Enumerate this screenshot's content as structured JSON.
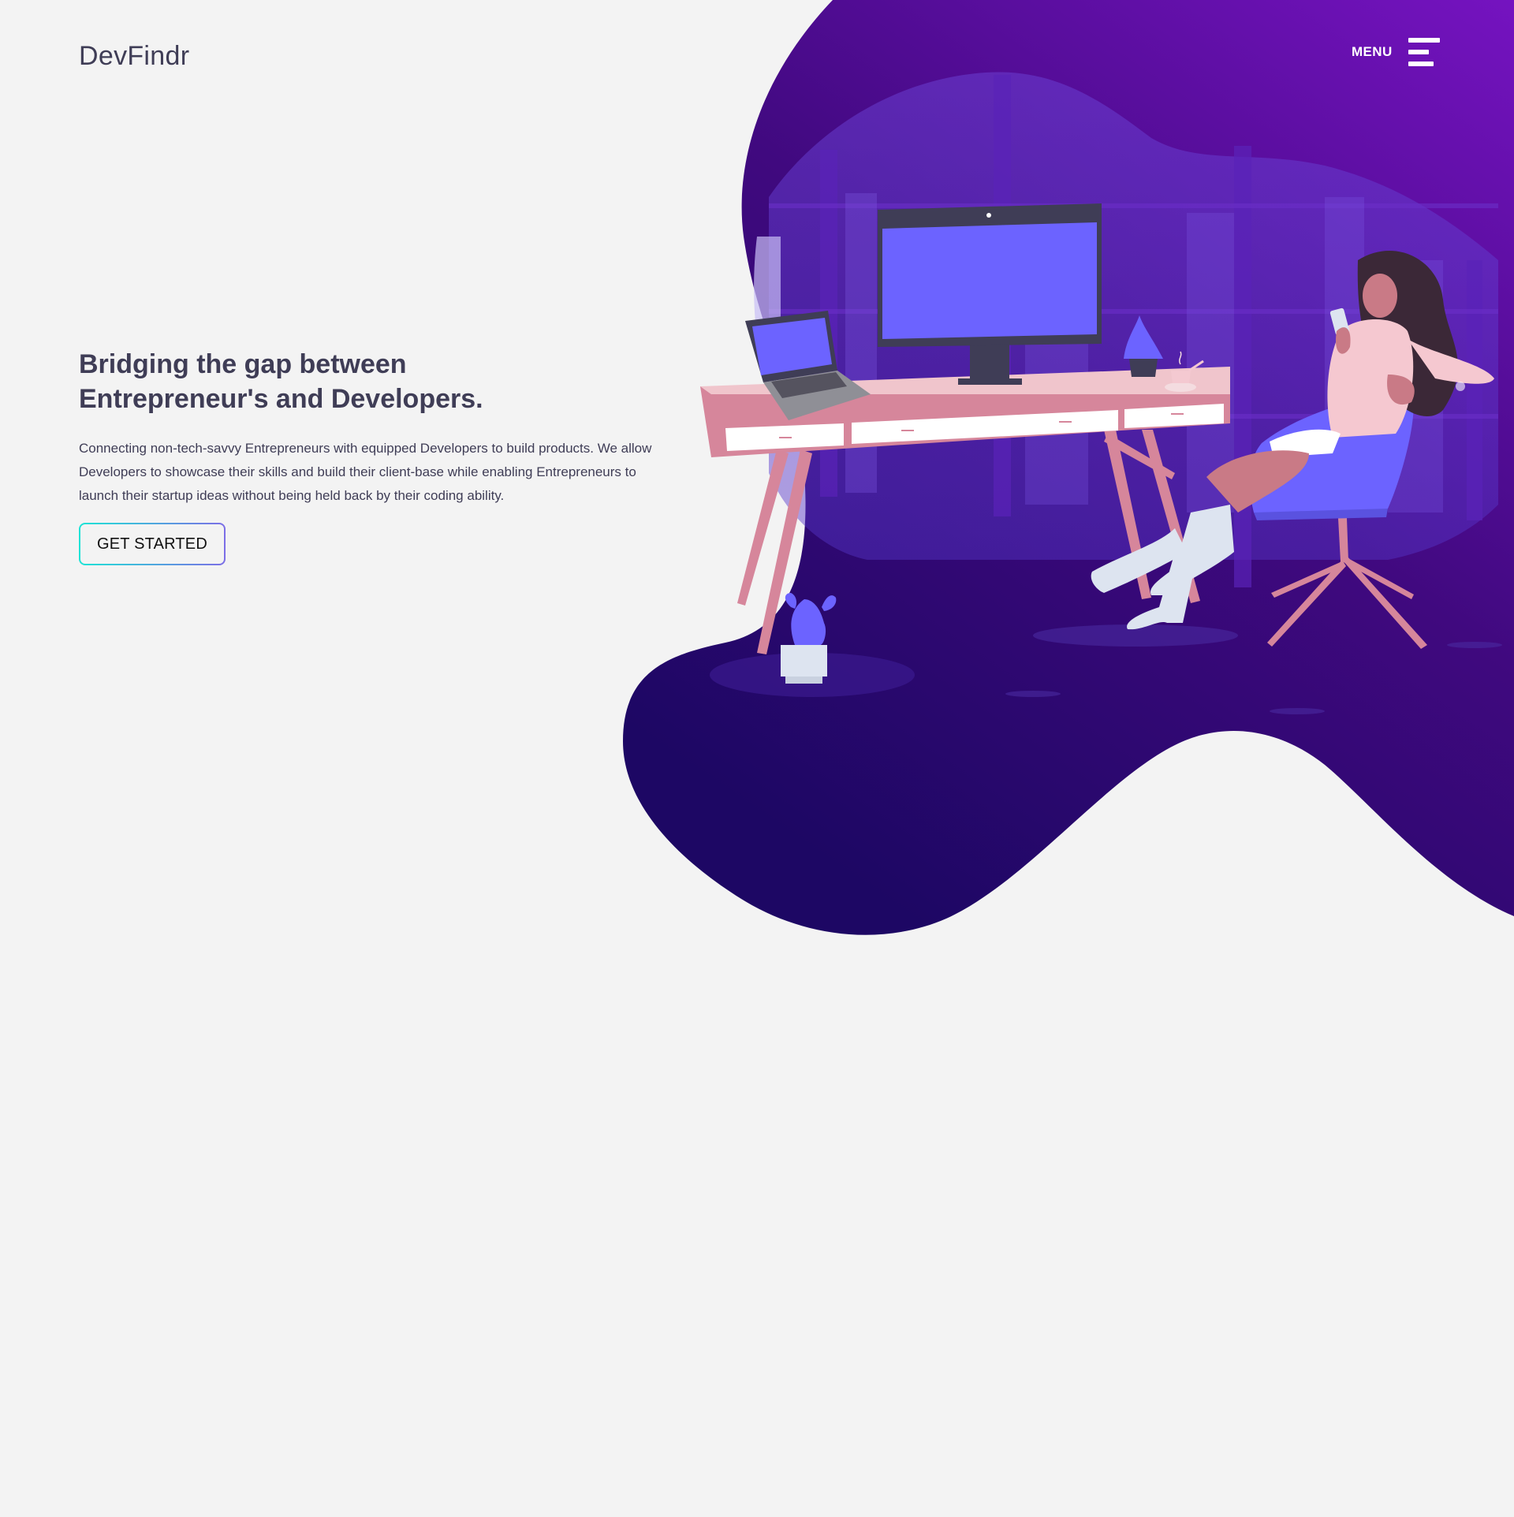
{
  "brand": {
    "name": "DevFindr"
  },
  "nav": {
    "menu_label": "MENU",
    "menu_icon": "hamburger-menu-icon"
  },
  "hero": {
    "title": "Bridging the gap between Entrepreneur's and Developers.",
    "description": "Connecting non-tech-savvy Entrepreneurs with equipped Developers to  build  products. We allow Developers to showcase their skills and build their client-base while enabling Entrepreneurs to launch their startup ideas without being held back  by their coding ability.",
    "cta_label": "GET STARTED"
  },
  "illustration": {
    "name": "woman-at-desk-illustration"
  },
  "colors": {
    "background": "#f3f3f3",
    "text": "#3f3d56",
    "blob_top": "#7513c0",
    "blob_bottom": "#1d0764",
    "screen": "#6c63ff",
    "desk": "#f0c5cc",
    "desk_leg": "#d6869b",
    "cta_gradient_start": "#1de4d6",
    "cta_gradient_end": "#7c6ee6"
  }
}
